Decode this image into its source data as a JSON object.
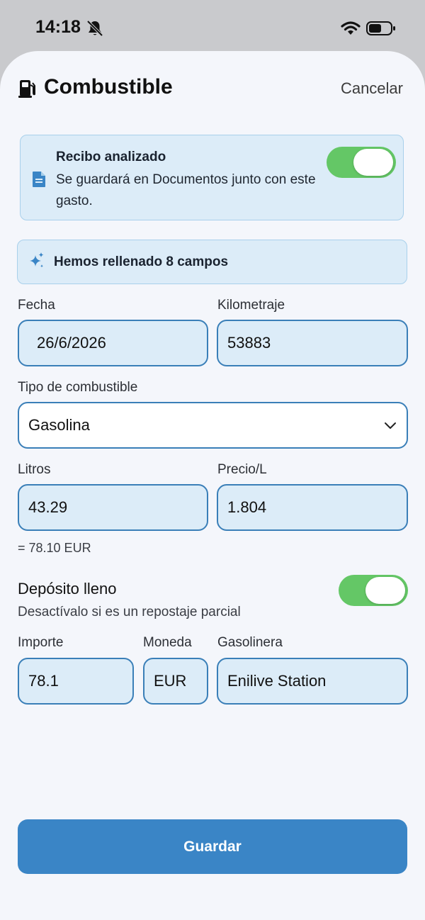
{
  "status_bar": {
    "time": "14:18"
  },
  "header": {
    "title": "Combustible",
    "cancel_label": "Cancelar"
  },
  "receipt_card": {
    "title": "Recibo analizado",
    "text": "Se guardará en Documentos junto con este gasto.",
    "toggle_on": true
  },
  "ai_banner": {
    "text": "Hemos rellenado 8 campos"
  },
  "form": {
    "date_label": "Fecha",
    "date_value": "26/6/2026",
    "km_label": "Kilometraje",
    "km_value": "53883",
    "fuel_type_label": "Tipo de combustible",
    "fuel_type_value": "Gasolina",
    "liters_label": "Litros",
    "liters_value": "43.29",
    "price_label": "Precio/L",
    "price_value": "1.804",
    "computed_total": "= 78.10 EUR",
    "full_tank_title": "Depósito lleno",
    "full_tank_hint": "Desactívalo si es un repostaje parcial",
    "full_tank_on": true,
    "amount_label": "Importe",
    "amount_value": "78.1",
    "currency_label": "Moneda",
    "currency_value": "EUR",
    "station_label": "Gasolinera",
    "station_value": "Enilive Station"
  },
  "save_label": "Guardar",
  "colors": {
    "accent": "#3a85c6",
    "toggle_on": "#64c766",
    "field_bg": "#dcecf8",
    "field_border": "#3a7fb8"
  },
  "icons": [
    "bell-slash-icon",
    "wifi-icon",
    "battery-icon",
    "fuel-pump-icon",
    "document-icon",
    "sparkles-icon",
    "chevron-down-icon"
  ]
}
